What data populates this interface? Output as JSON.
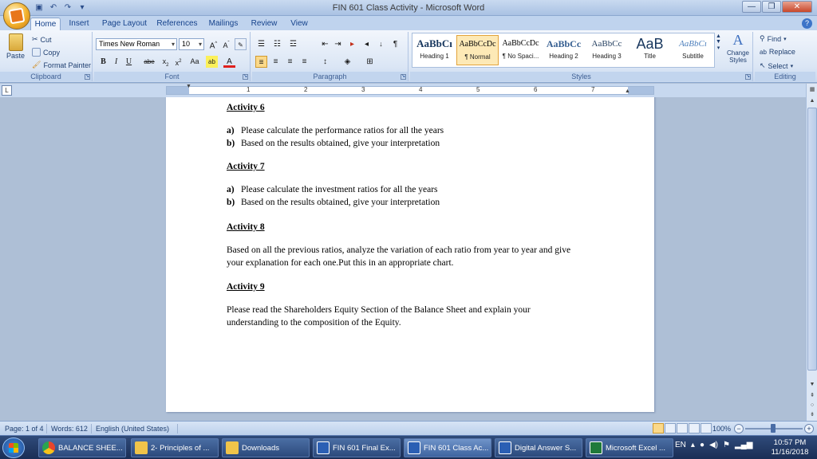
{
  "window": {
    "title": "FIN 601 Class Activity - Microsoft Word"
  },
  "tabs": [
    "Home",
    "Insert",
    "Page Layout",
    "References",
    "Mailings",
    "Review",
    "View"
  ],
  "ribbon": {
    "clipboard": {
      "paste": "Paste",
      "cut": "Cut",
      "copy": "Copy",
      "format_painter": "Format Painter",
      "label": "Clipboard"
    },
    "font": {
      "name": "Times New Roman",
      "size": "10",
      "label": "Font"
    },
    "paragraph": {
      "label": "Paragraph"
    },
    "styles": {
      "label": "Styles",
      "items": [
        {
          "sample": "AaBbCı",
          "name": "Heading 1"
        },
        {
          "sample": "AaBbCcDc",
          "name": "¶ Normal"
        },
        {
          "sample": "AaBbCcDc",
          "name": "¶ No Spaci..."
        },
        {
          "sample": "AaBbCc",
          "name": "Heading 2"
        },
        {
          "sample": "AaBbCc",
          "name": "Heading 3"
        },
        {
          "sample": "AaB",
          "name": "Title"
        },
        {
          "sample": "AaBbCı",
          "name": "Subtitle"
        }
      ],
      "change_styles": "Change Styles"
    },
    "editing": {
      "find": "Find",
      "replace": "Replace",
      "select": "Select",
      "label": "Editing"
    }
  },
  "document": {
    "activity6": {
      "heading": "Activity 6",
      "items": [
        {
          "marker": "a)",
          "text": "Please calculate the performance ratios for all the years"
        },
        {
          "marker": "b)",
          "text": "Based on the results obtained, give your interpretation"
        }
      ]
    },
    "activity7": {
      "heading": "Activity 7",
      "items": [
        {
          "marker": "a)",
          "text": "Please calculate the investment ratios for all the years"
        },
        {
          "marker": "b)",
          "text": "Based on the results obtained, give your interpretation"
        }
      ]
    },
    "activity8": {
      "heading": "Activity 8",
      "text": "Based on all the previous ratios, analyze the variation of each ratio from year to year and give your explanation for each one.Put this in an appropriate chart."
    },
    "activity9": {
      "heading": "Activity 9",
      "text": "Please read the Shareholders Equity Section of the Balance Sheet and explain your understanding to the composition of the Equity."
    }
  },
  "status": {
    "page": "Page: 1 of 4",
    "words": "Words: 612",
    "language": "English (United States)",
    "zoom": "100%"
  },
  "taskbar": {
    "items": [
      {
        "label": "BALANCE SHEE...",
        "icon_color": "#e8452c"
      },
      {
        "label": "2- Principles of ...",
        "icon_color": "#f0c44a"
      },
      {
        "label": "Downloads",
        "icon_color": "#f0c44a"
      },
      {
        "label": "FIN 601 Final Ex...",
        "icon_color": "#2b5fb4"
      },
      {
        "label": "FIN 601 Class Ac...",
        "icon_color": "#2b5fb4"
      },
      {
        "label": "Digital Answer S...",
        "icon_color": "#2b5fb4"
      },
      {
        "label": "Microsoft Excel ...",
        "icon_color": "#1f7a3a"
      }
    ],
    "language": "EN",
    "time": "10:57 PM",
    "date": "11/16/2018"
  },
  "ruler": {
    "numbers": [
      "1",
      "2",
      "3",
      "4",
      "5",
      "6",
      "7"
    ]
  }
}
